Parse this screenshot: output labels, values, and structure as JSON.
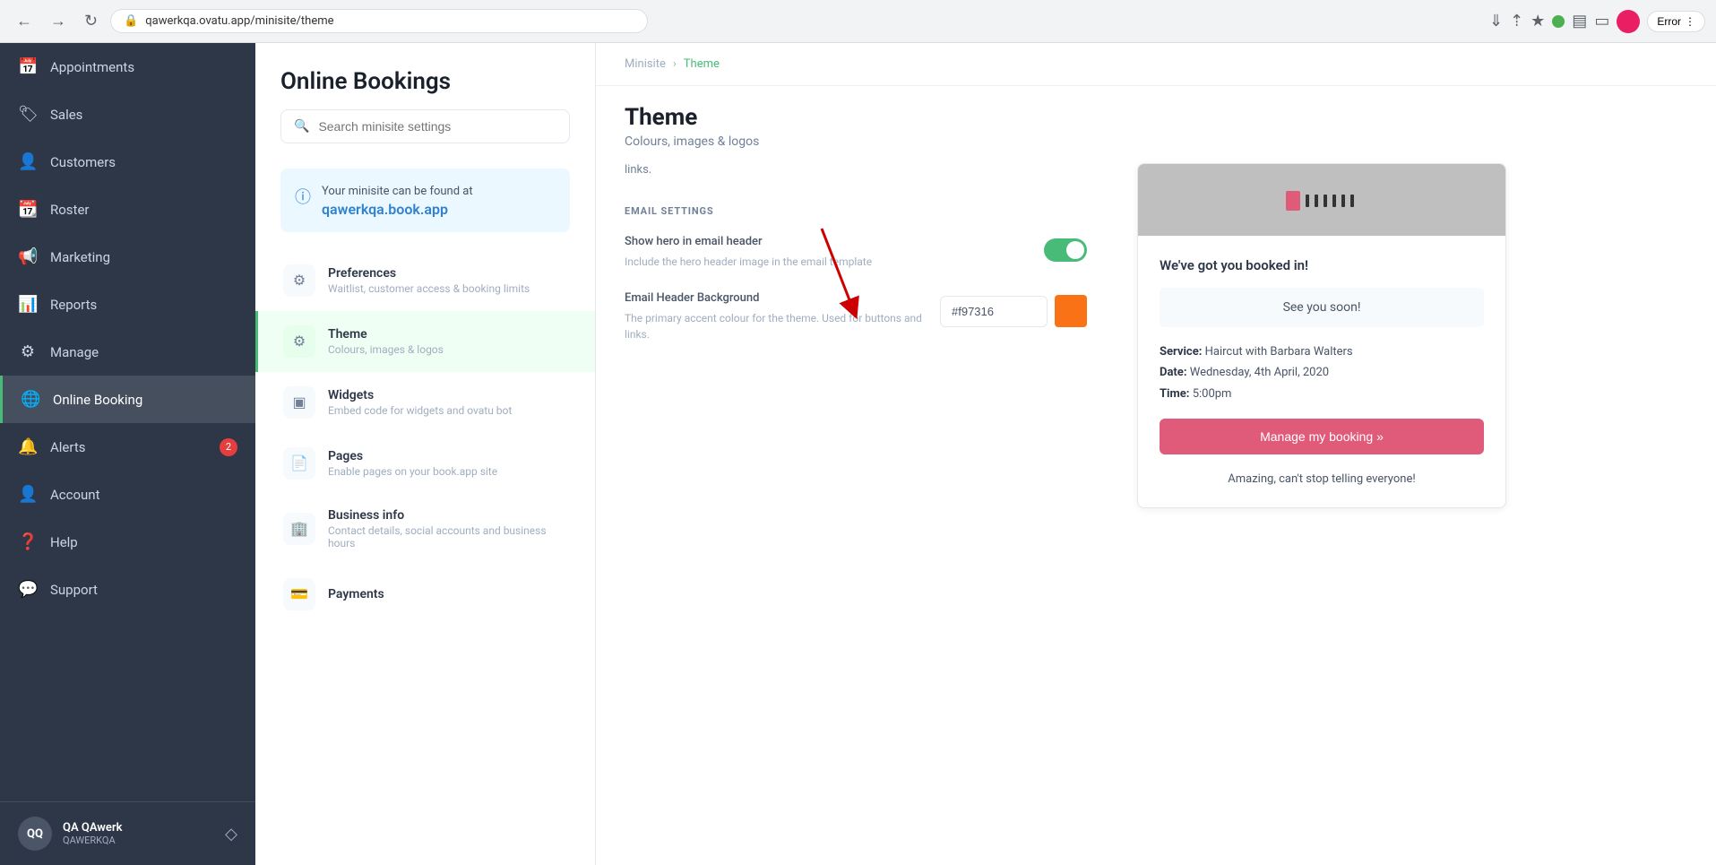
{
  "browser": {
    "back_btn": "←",
    "forward_btn": "→",
    "reload_btn": "↻",
    "url": "qawerkqa.ovatu.app/minisite/theme",
    "lock_icon": "🔒",
    "error_label": "Error"
  },
  "sidebar": {
    "items": [
      {
        "id": "appointments",
        "label": "Appointments",
        "icon": "📅"
      },
      {
        "id": "sales",
        "label": "Sales",
        "icon": "🏷"
      },
      {
        "id": "customers",
        "label": "Customers",
        "icon": "👤"
      },
      {
        "id": "roster",
        "label": "Roster",
        "icon": "📆"
      },
      {
        "id": "marketing",
        "label": "Marketing",
        "icon": "📣"
      },
      {
        "id": "reports",
        "label": "Reports",
        "icon": "📊"
      },
      {
        "id": "manage",
        "label": "Manage",
        "icon": "⚙️"
      },
      {
        "id": "online-booking",
        "label": "Online Booking",
        "icon": "🌐",
        "active": true
      },
      {
        "id": "alerts",
        "label": "Alerts",
        "icon": "🔔",
        "badge": "2"
      },
      {
        "id": "account",
        "label": "Account",
        "icon": "👤"
      },
      {
        "id": "help",
        "label": "Help",
        "icon": "❓"
      },
      {
        "id": "support",
        "label": "Support",
        "icon": "💬"
      }
    ],
    "user": {
      "initials": "QQ",
      "name": "QA QAwerk",
      "sub": "QAWERKQA"
    }
  },
  "middle_panel": {
    "title": "Online Bookings",
    "search_placeholder": "Search minisite settings",
    "info_text": "Your minisite can be found at",
    "info_link": "qawerkqa.book.app",
    "nav_items": [
      {
        "id": "preferences",
        "label": "Preferences",
        "sub": "Waitlist, customer access & booking limits",
        "icon": "⚙"
      },
      {
        "id": "theme",
        "label": "Theme",
        "sub": "Colours, images & logos",
        "icon": "⚙",
        "active": true
      },
      {
        "id": "widgets",
        "label": "Widgets",
        "sub": "Embed code for widgets and ovatu bot",
        "icon": "⊞"
      },
      {
        "id": "pages",
        "label": "Pages",
        "sub": "Enable pages on your book.app site",
        "icon": "📄"
      },
      {
        "id": "business-info",
        "label": "Business info",
        "sub": "Contact details, social accounts and business hours",
        "icon": "🏢"
      },
      {
        "id": "payments",
        "label": "Payments",
        "sub": "",
        "icon": "💳"
      }
    ]
  },
  "main": {
    "breadcrumb": {
      "parent": "Minisite",
      "current": "Theme"
    },
    "title": "Theme",
    "subtitle": "Colours, images & logos",
    "top_text": "links.",
    "sections": {
      "email_settings": {
        "label": "EMAIL SETTINGS",
        "hero_field": {
          "label": "Show hero in email header",
          "desc": "Include the hero header image in the email template",
          "toggle_on": true
        },
        "bg_field": {
          "label": "Email Header Background",
          "desc": "The primary accent colour for the theme. Used for buttons and links.",
          "color_value": "#f97316"
        }
      }
    },
    "preview": {
      "booked_text": "We've got you booked in!",
      "see_you_text": "See you soon!",
      "service_label": "Service:",
      "service_value": "Haircut with Barbara Walters",
      "date_label": "Date:",
      "date_value": "Wednesday, 4th April, 2020",
      "time_label": "Time:",
      "time_value": "5:00pm",
      "manage_btn": "Manage my booking »",
      "footer_text": "Amazing, can't stop telling everyone!"
    }
  }
}
